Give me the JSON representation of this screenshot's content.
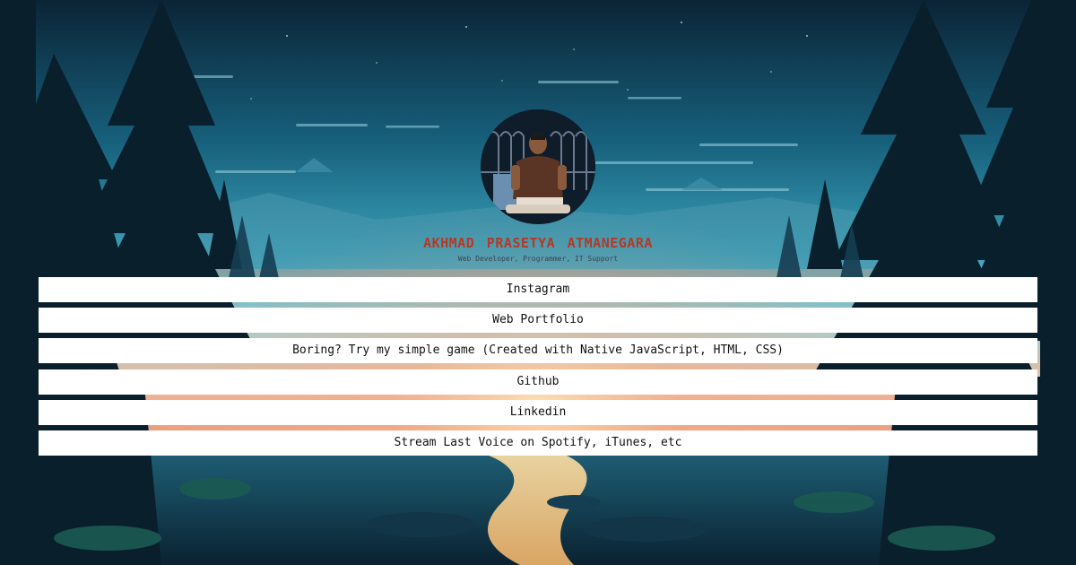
{
  "profile": {
    "name": "AKHMAD PRASETYA ATMANEGARA",
    "subtitle": "Web Developer, Programmer, IT Support",
    "avatar_icon": "person-photo"
  },
  "links": [
    {
      "label": "Instagram"
    },
    {
      "label": "Web Portfolio"
    },
    {
      "label": "Boring? Try my simple game (Created with Native JavaScript, HTML, CSS)"
    },
    {
      "label": "Github"
    },
    {
      "label": "Linkedin"
    },
    {
      "label": "Stream Last Voice on Spotify, iTunes, etc"
    }
  ],
  "colors": {
    "name_color": "#b23a28",
    "button_bg": "#ffffff",
    "sky_top": "#0c2a44",
    "sky_mid": "#2b8aa6",
    "horizon": "#e8b89a"
  }
}
